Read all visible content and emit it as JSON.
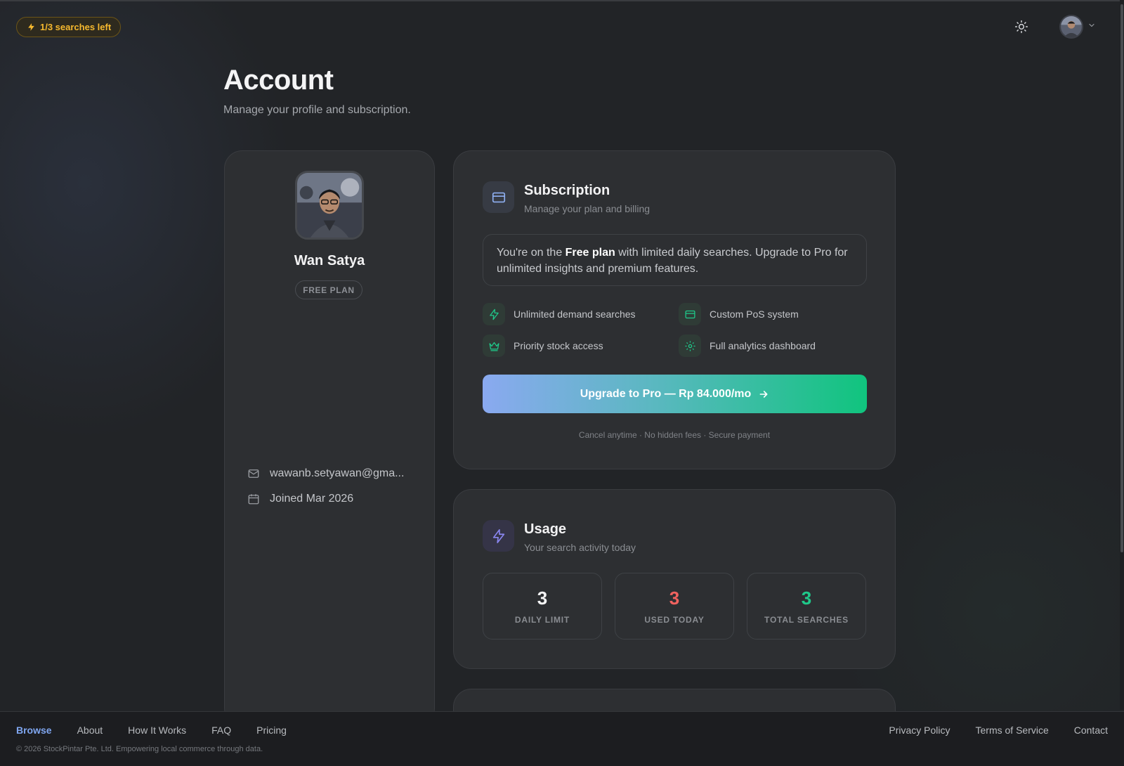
{
  "header": {
    "searches_left": "1/3 searches left"
  },
  "page": {
    "title": "Account",
    "subtitle": "Manage your profile and subscription."
  },
  "profile": {
    "name": "Wan Satya",
    "plan_badge": "FREE PLAN",
    "email": "wawanb.setyawan@gma...",
    "joined": "Joined Mar 2026"
  },
  "subscription": {
    "title": "Subscription",
    "subtitle": "Manage your plan and billing",
    "note_prefix": "You're on the ",
    "note_plan": "Free plan",
    "note_suffix": " with limited daily searches. Upgrade to Pro for unlimited insights and premium features.",
    "features": [
      {
        "label": "Unlimited demand searches",
        "icon": "bolt-icon"
      },
      {
        "label": "Custom PoS system",
        "icon": "card-icon"
      },
      {
        "label": "Priority stock access",
        "icon": "crown-icon"
      },
      {
        "label": "Full analytics dashboard",
        "icon": "gear-icon"
      }
    ],
    "upgrade_label": "Upgrade to Pro — Rp 84.000/mo",
    "fine_print": "Cancel anytime · No hidden fees · Secure payment"
  },
  "usage": {
    "title": "Usage",
    "subtitle": "Your search activity today",
    "stats": [
      {
        "value": "3",
        "label": "DAILY LIMIT",
        "color": "#f4f4f5"
      },
      {
        "value": "3",
        "label": "USED TODAY",
        "color": "#f0625f"
      },
      {
        "value": "3",
        "label": "TOTAL SEARCHES",
        "color": "#1fc98a"
      }
    ]
  },
  "footer": {
    "nav": [
      "Browse",
      "About",
      "How It Works",
      "FAQ",
      "Pricing"
    ],
    "legal": [
      "Privacy Policy",
      "Terms of Service",
      "Contact"
    ],
    "copyright": "© 2026 StockPintar Pte. Ltd. Empowering local commerce through data."
  },
  "colors": {
    "accent_green": "#10c47e",
    "accent_blue": "#7fa6f0",
    "warning": "#f5b82e"
  }
}
